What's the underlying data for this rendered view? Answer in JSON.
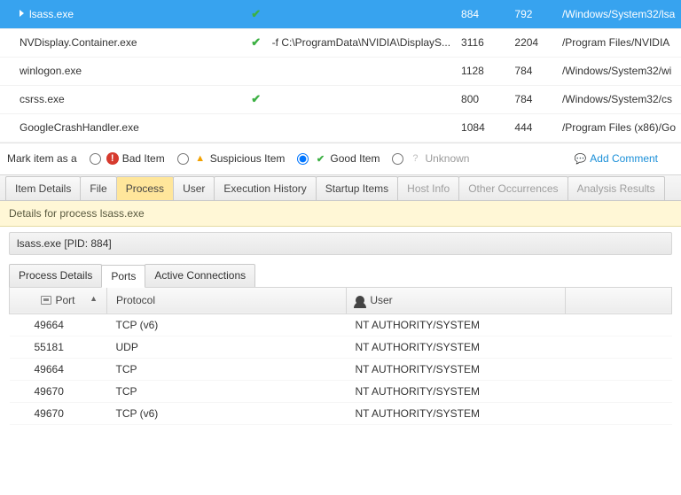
{
  "processes": [
    {
      "name": "lsass.exe",
      "checked": true,
      "args": "",
      "pid": "884",
      "ppid": "792",
      "path": "/Windows/System32/lsa",
      "selected": true,
      "expand": true
    },
    {
      "name": "NVDisplay.Container.exe",
      "checked": true,
      "args": "-f C:\\ProgramData\\NVIDIA\\DisplayS...",
      "pid": "3116",
      "ppid": "2204",
      "path": "/Program Files/NVIDIA"
    },
    {
      "name": "winlogon.exe",
      "checked": false,
      "args": "",
      "pid": "1128",
      "ppid": "784",
      "path": "/Windows/System32/wi"
    },
    {
      "name": "csrss.exe",
      "checked": true,
      "args": "",
      "pid": "800",
      "ppid": "784",
      "path": "/Windows/System32/cs"
    },
    {
      "name": "GoogleCrashHandler.exe",
      "checked": false,
      "args": "",
      "pid": "1084",
      "ppid": "444",
      "path": "/Program Files (x86)/Go"
    }
  ],
  "markbar": {
    "label": "Mark item as a",
    "bad": "Bad Item",
    "sus": "Suspicious Item",
    "good": "Good Item",
    "unknown": "Unknown",
    "add": "Add Comment",
    "selected": "good"
  },
  "detail_tabs": [
    {
      "label": "Item Details",
      "dis": false
    },
    {
      "label": "File",
      "dis": false
    },
    {
      "label": "Process",
      "dis": false,
      "active": true
    },
    {
      "label": "User",
      "dis": false
    },
    {
      "label": "Execution History",
      "dis": false
    },
    {
      "label": "Startup Items",
      "dis": false
    },
    {
      "label": "Host Info",
      "dis": true
    },
    {
      "label": "Other Occurrences",
      "dis": true
    },
    {
      "label": "Analysis Results",
      "dis": true
    }
  ],
  "strip": "Details for process lsass.exe",
  "crumb": "lsass.exe  [PID: 884]",
  "inner_tabs": [
    {
      "label": "Process Details"
    },
    {
      "label": "Ports",
      "active": true
    },
    {
      "label": "Active Connections"
    }
  ],
  "ports_header": {
    "port": "Port",
    "proto": "Protocol",
    "user": "User"
  },
  "ports": [
    {
      "port": "49664",
      "proto": "TCP (v6)",
      "user": "NT AUTHORITY/SYSTEM"
    },
    {
      "port": "55181",
      "proto": "UDP",
      "user": "NT AUTHORITY/SYSTEM"
    },
    {
      "port": "49664",
      "proto": "TCP",
      "user": "NT AUTHORITY/SYSTEM"
    },
    {
      "port": "49670",
      "proto": "TCP",
      "user": "NT AUTHORITY/SYSTEM"
    },
    {
      "port": "49670",
      "proto": "TCP (v6)",
      "user": "NT AUTHORITY/SYSTEM"
    }
  ]
}
